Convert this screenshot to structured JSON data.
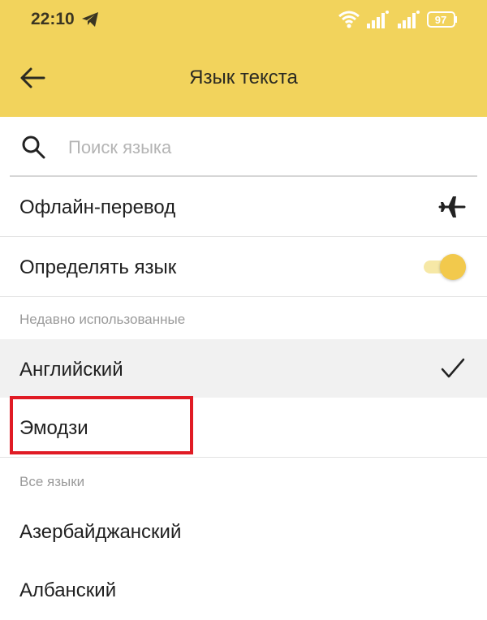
{
  "status_bar": {
    "time": "22:10",
    "battery_level": "97",
    "icons": [
      "telegram-icon",
      "wifi-icon",
      "signal-icon",
      "signal-icon",
      "battery-icon"
    ]
  },
  "header": {
    "title": "Язык текста",
    "back_icon": "arrow-left-icon"
  },
  "search": {
    "placeholder": "Поиск языка",
    "value": "",
    "icon": "search-icon"
  },
  "settings": {
    "offline_label": "Офлайн-перевод",
    "offline_icon": "airplane-icon",
    "detect_label": "Определять язык",
    "detect_enabled": true
  },
  "recent": {
    "header": "Недавно использованные",
    "items": [
      {
        "label": "Английский",
        "selected": true
      },
      {
        "label": "Эмодзи",
        "selected": false,
        "highlighted": true
      }
    ]
  },
  "all": {
    "header": "Все языки",
    "items": [
      {
        "label": "Азербайджанский"
      },
      {
        "label": "Албанский"
      }
    ]
  },
  "colors": {
    "header_bg": "#f2d35c",
    "toggle_thumb": "#f2c94c",
    "highlight_border": "#e01b24",
    "selected_row_bg": "#f1f1f1"
  }
}
